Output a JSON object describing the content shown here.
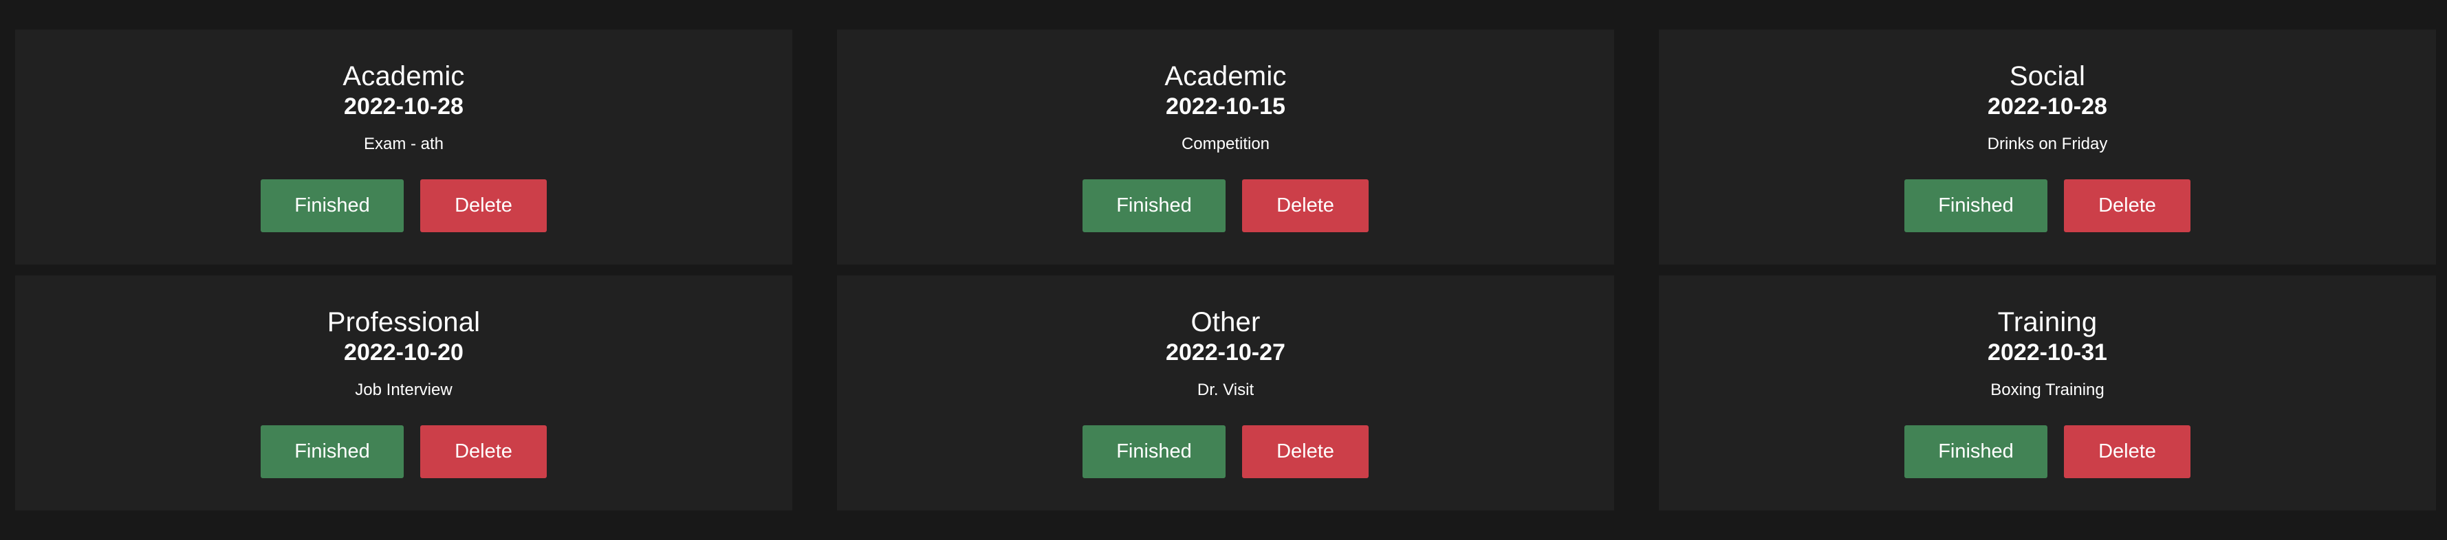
{
  "colors": {
    "background": "#181818",
    "card": "#212121",
    "finished": "#428355",
    "delete": "#cc3f49"
  },
  "cards": [
    {
      "category": "Academic",
      "date": "2022-10-28",
      "description": "Exam - ath",
      "finished_label": "Finished",
      "delete_label": "Delete"
    },
    {
      "category": "Academic",
      "date": "2022-10-15",
      "description": "Competition",
      "finished_label": "Finished",
      "delete_label": "Delete"
    },
    {
      "category": "Social",
      "date": "2022-10-28",
      "description": "Drinks on Friday",
      "finished_label": "Finished",
      "delete_label": "Delete"
    },
    {
      "category": "Professional",
      "date": "2022-10-20",
      "description": "Job Interview",
      "finished_label": "Finished",
      "delete_label": "Delete"
    },
    {
      "category": "Other",
      "date": "2022-10-27",
      "description": "Dr. Visit",
      "finished_label": "Finished",
      "delete_label": "Delete"
    },
    {
      "category": "Training",
      "date": "2022-10-31",
      "description": "Boxing Training",
      "finished_label": "Finished",
      "delete_label": "Delete"
    }
  ]
}
